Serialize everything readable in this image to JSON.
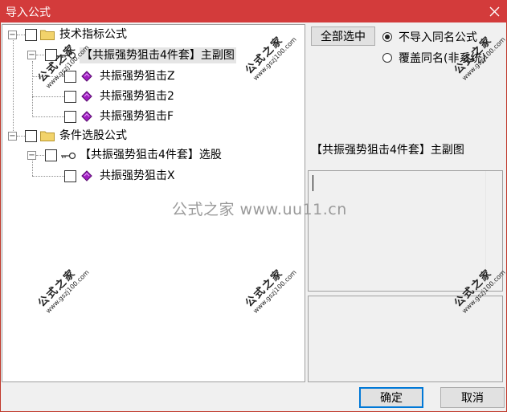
{
  "window": {
    "title": "导入公式",
    "close_icon": "close-icon"
  },
  "tree": {
    "groups": [
      {
        "label": "技术指标公式",
        "children": [
          {
            "label": "【共振强势狙击4件套】主副图",
            "children": [
              "共振强势狙击Z",
              "共振强势狙击2",
              "共振强势狙击F"
            ]
          }
        ]
      },
      {
        "label": "条件选股公式",
        "children": [
          {
            "label": "【共振强势狙击4件套】选股",
            "children": [
              "共振强势狙击X"
            ]
          }
        ]
      }
    ]
  },
  "options": {
    "select_all_label": "全部选中",
    "radio_skip_label": "不导入同名公式",
    "radio_overwrite_label": "覆盖同名(非系统)",
    "selected_radio": "skip"
  },
  "detail": {
    "formula_name": "【共振强势狙击4件套】主副图"
  },
  "footer": {
    "ok_label": "确定",
    "cancel_label": "取消"
  },
  "watermarks": {
    "stamp_text": "公式之家",
    "stamp_url": "www.gszj100.com",
    "center_text": "公式之家 www.uu11.cn"
  }
}
